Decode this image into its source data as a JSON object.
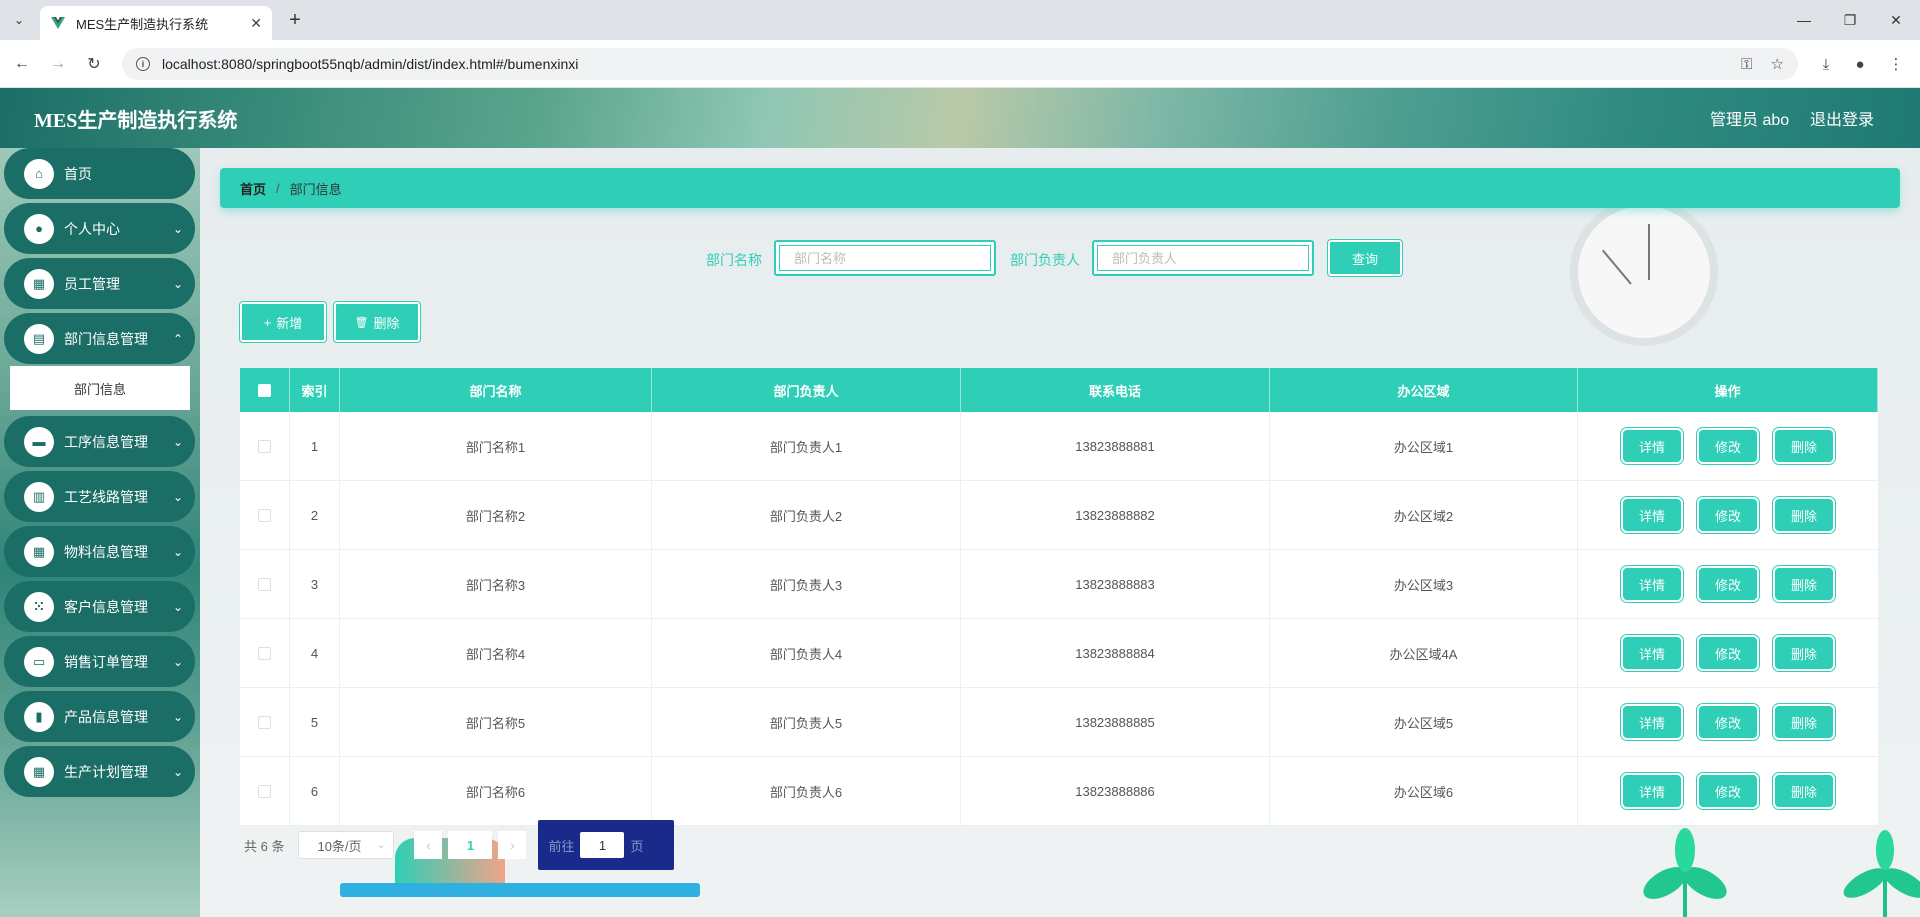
{
  "browser": {
    "tab_title": "MES生产制造执行系统",
    "url": "localhost:8080/springboot55nqb/admin/dist/index.html#/bumenxinxi"
  },
  "header": {
    "app_title": "MES生产制造执行系统",
    "user": "管理员 abo",
    "logout": "退出登录"
  },
  "sidebar": {
    "items": [
      {
        "label": "首页",
        "icon": "home-icon",
        "glyph": "⌂",
        "arrow": ""
      },
      {
        "label": "个人中心",
        "icon": "user-icon",
        "glyph": "●",
        "arrow": "⌄"
      },
      {
        "label": "员工管理",
        "icon": "grid-icon",
        "glyph": "▦",
        "arrow": "⌄"
      },
      {
        "label": "部门信息管理",
        "icon": "chart-icon",
        "glyph": "▤",
        "arrow": "⌃"
      },
      {
        "label": "工序信息管理",
        "icon": "chat-icon",
        "glyph": "▬",
        "arrow": "⌄"
      },
      {
        "label": "工艺线路管理",
        "icon": "clipboard-icon",
        "glyph": "▥",
        "arrow": "⌄"
      },
      {
        "label": "物料信息管理",
        "icon": "grid-icon",
        "glyph": "▦",
        "arrow": "⌄"
      },
      {
        "label": "客户信息管理",
        "icon": "apps-icon",
        "glyph": "⁙",
        "arrow": "⌄"
      },
      {
        "label": "销售订单管理",
        "icon": "monitor-icon",
        "glyph": "▭",
        "arrow": "⌄"
      },
      {
        "label": "产品信息管理",
        "icon": "book-icon",
        "glyph": "▮",
        "arrow": "⌄"
      },
      {
        "label": "生产计划管理",
        "icon": "grid-icon",
        "glyph": "▦",
        "arrow": "⌄"
      }
    ],
    "active_sub": "部门信息"
  },
  "breadcrumb": {
    "home": "首页",
    "sep": "/",
    "current": "部门信息"
  },
  "search": {
    "name_label": "部门名称",
    "name_placeholder": "部门名称",
    "head_label": "部门负责人",
    "head_placeholder": "部门负责人",
    "query_label": "查询"
  },
  "actions": {
    "add": "新增",
    "delete": "删除"
  },
  "table": {
    "columns": [
      "索引",
      "部门名称",
      "部门负责人",
      "联系电话",
      "办公区域",
      "操作"
    ],
    "ops": [
      "详情",
      "修改",
      "删除"
    ],
    "rows": [
      {
        "idx": "1",
        "name": "部门名称1",
        "head": "部门负责人1",
        "phone": "13823888881",
        "area": "办公区域1"
      },
      {
        "idx": "2",
        "name": "部门名称2",
        "head": "部门负责人2",
        "phone": "13823888882",
        "area": "办公区域2"
      },
      {
        "idx": "3",
        "name": "部门名称3",
        "head": "部门负责人3",
        "phone": "13823888883",
        "area": "办公区域3"
      },
      {
        "idx": "4",
        "name": "部门名称4",
        "head": "部门负责人4",
        "phone": "13823888884",
        "area": "办公区域4A"
      },
      {
        "idx": "5",
        "name": "部门名称5",
        "head": "部门负责人5",
        "phone": "13823888885",
        "area": "办公区域5"
      },
      {
        "idx": "6",
        "name": "部门名称6",
        "head": "部门负责人6",
        "phone": "13823888886",
        "area": "办公区域6"
      }
    ]
  },
  "pagination": {
    "total": "共 6 条",
    "page_size": "10条/页",
    "current_page": "1",
    "goto_prefix": "前往",
    "goto_value": "1",
    "goto_suffix": "页"
  },
  "colors": {
    "accent": "#2fcfb7",
    "sidebar_item": "#1b6e66"
  }
}
